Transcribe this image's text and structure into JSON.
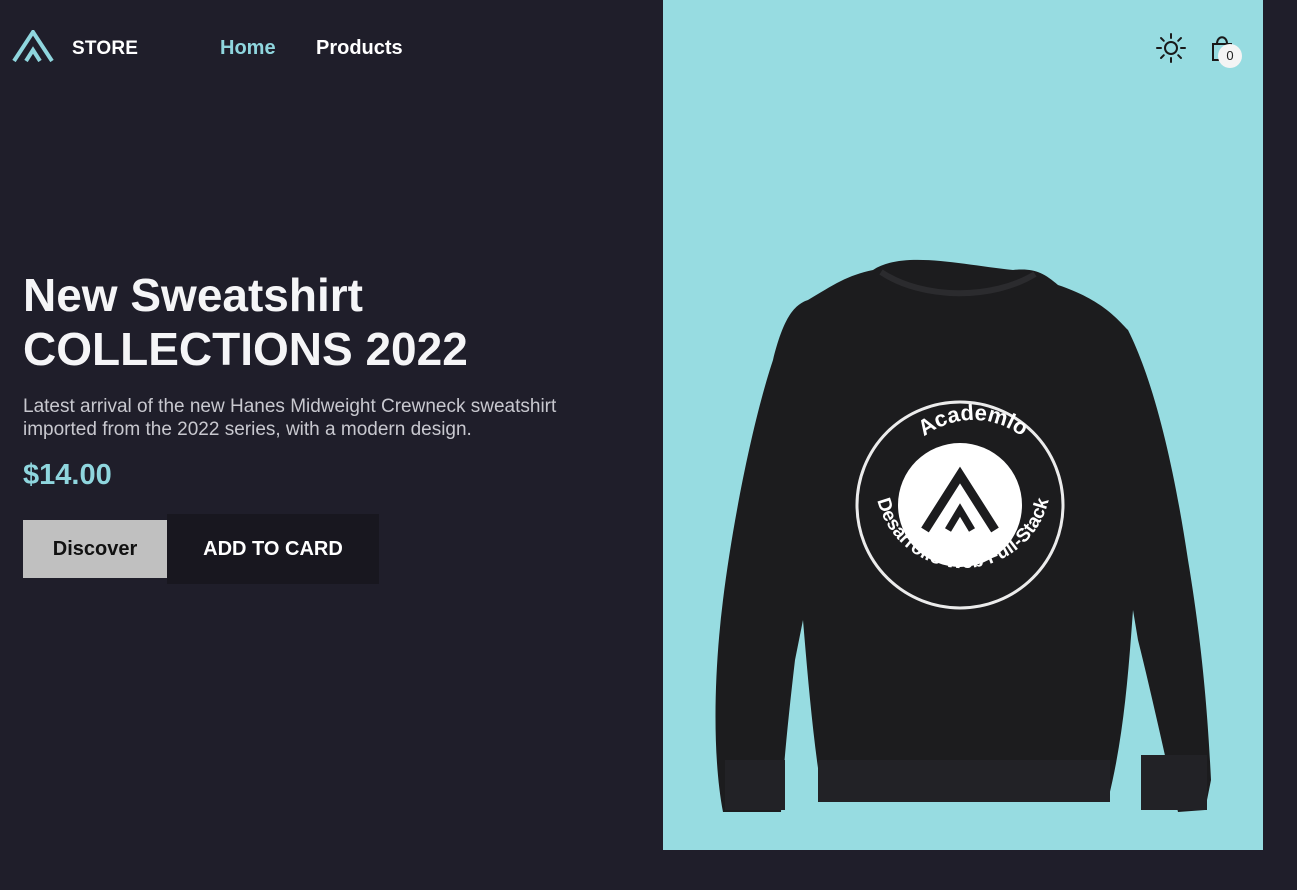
{
  "header": {
    "brand": "STORE",
    "nav": [
      {
        "label": "Home",
        "active": true
      },
      {
        "label": "Products",
        "active": false
      }
    ],
    "icons": {
      "logo": "academlo-logo-icon",
      "theme": "sun-icon",
      "cart": "shopping-bag-icon"
    },
    "cart_count": "0"
  },
  "hero": {
    "title_line1": "New Sweatshirt",
    "title_line2": "COLLECTIONS 2022",
    "description": "Latest arrival of the new Hanes Midweight Crewneck sweatshirt imported from the 2022 series, with a modern design.",
    "price": "$14.00",
    "discover_label": "Discover",
    "add_label": "ADD TO CARD"
  },
  "product_image": {
    "print_top": "Academlo",
    "print_bottom": "Desarrollo Web Full-Stack"
  },
  "colors": {
    "background": "#1f1e2a",
    "accent": "#8fd6de",
    "panel": "#97dce1",
    "discover_button": "#c0c0c0",
    "add_button": "#18171f"
  }
}
